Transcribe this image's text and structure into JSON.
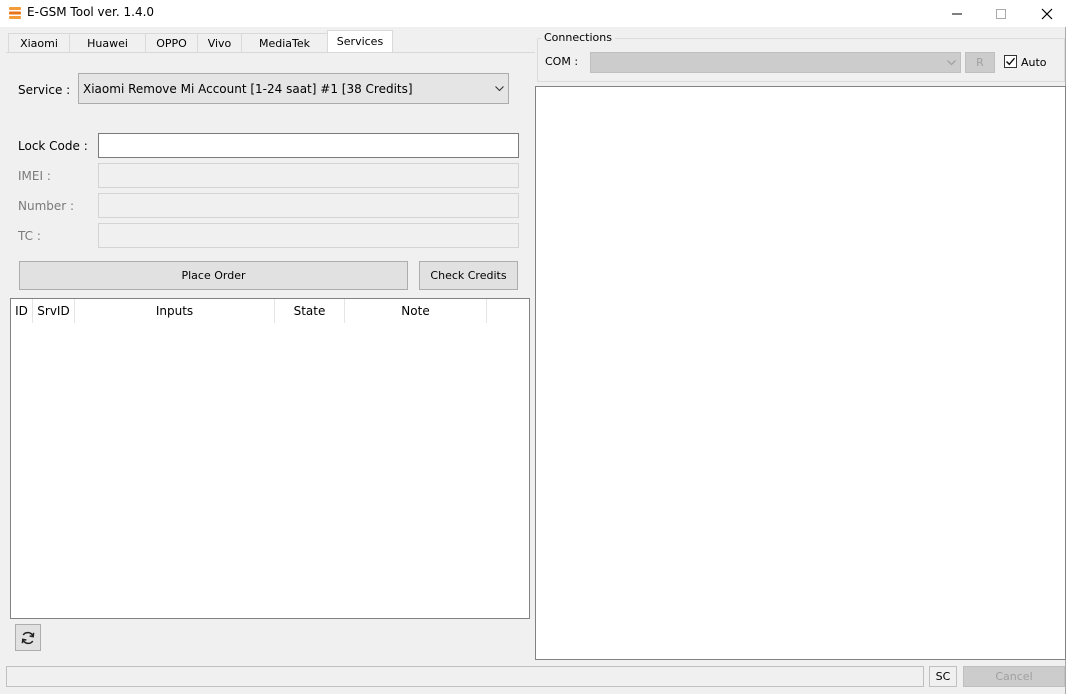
{
  "window": {
    "title": "E-GSM Tool ver. 1.4.0",
    "accent": "#e8731a"
  },
  "tabs": [
    {
      "label": "Xiaomi"
    },
    {
      "label": "Huawei"
    },
    {
      "label": "OPPO"
    },
    {
      "label": "Vivo"
    },
    {
      "label": "MediaTek"
    },
    {
      "label": "Services",
      "selected": true
    }
  ],
  "services": {
    "service_label": "Service :",
    "service_value": "Xiaomi Remove Mi Account [1-24 saat] #1 [38 Credits]",
    "lock_code_label": "Lock Code :",
    "lock_code_value": "",
    "imei_label": "IMEI :",
    "imei_value": "",
    "number_label": "Number :",
    "number_value": "",
    "tc_label": "TC :",
    "tc_value": "",
    "place_order_label": "Place Order",
    "check_credits_label": "Check Credits",
    "columns": [
      "ID",
      "SrvID",
      "Inputs",
      "State",
      "Note"
    ],
    "refresh_icon": "refresh-icon"
  },
  "connections": {
    "group_label": "Connections",
    "com_label": "COM :",
    "com_value": "",
    "r_button_label": "R",
    "auto_label": "Auto",
    "auto_checked": true
  },
  "statusbar": {
    "sc_label": "SC",
    "cancel_label": "Cancel"
  }
}
